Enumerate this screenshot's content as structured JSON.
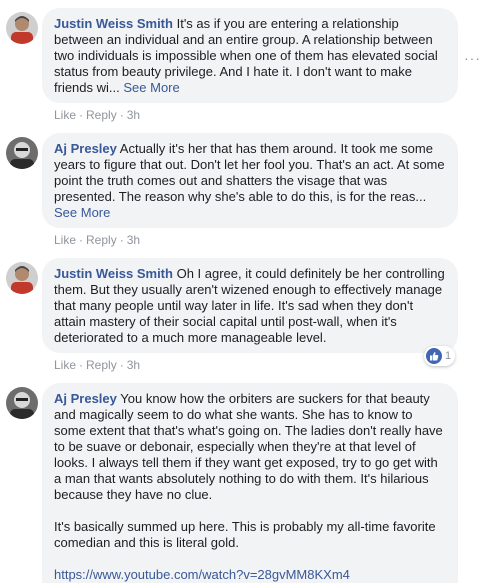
{
  "comments": [
    {
      "author": "Justin Weiss Smith",
      "text": "It's as if you are entering a relationship between an individual and an entire group. A relationship between two individuals is impossible when one of them has elevated social status from beauty privilege. And I hate it. I don't want to make friends wi...",
      "see_more": "See More",
      "like": "Like",
      "reply": "Reply",
      "time": "3h",
      "more": "···"
    },
    {
      "author": "Aj Presley",
      "text": "Actually it's her that has them around. It took me some years to figure that out. Don't let her fool you. That's an act. At some point the truth comes out and shatters the visage that was presented. The reason why she's able to do this, is for the reas...",
      "see_more": "See More",
      "like": "Like",
      "reply": "Reply",
      "time": "3h"
    },
    {
      "author": "Justin Weiss Smith",
      "text": "Oh I agree, it could definitely be her controlling them. But they usually aren't wizened enough to effectively manage that many people until way later in life. It's sad when they don't attain mastery of their social capital until post-wall, when it's deteriorated to a much more manageable level.",
      "like": "Like",
      "reply": "Reply",
      "time": "3h",
      "reaction_count": "1"
    },
    {
      "author": "Aj Presley",
      "text": "You know how the orbiters are suckers for that beauty and magically seem to do what she wants. She has to know to some extent that that's what's going on. The ladies don't really have to be suave or debonair, especially when they're at that level of looks. I always tell them if they want get exposed, try to go get with a man that wants absolutely nothing to do with them. It's hilarious because they have no clue.",
      "text2": "It's basically summed up here. This is probably my all-time favorite comedian and this is literal gold.",
      "link": "https://www.youtube.com/watch?v=28gvMM8KXm4"
    }
  ],
  "colors": {
    "bubble": "#f2f3f5",
    "author": "#385898",
    "meta": "#90949c",
    "like_blue": "#4267b2"
  }
}
